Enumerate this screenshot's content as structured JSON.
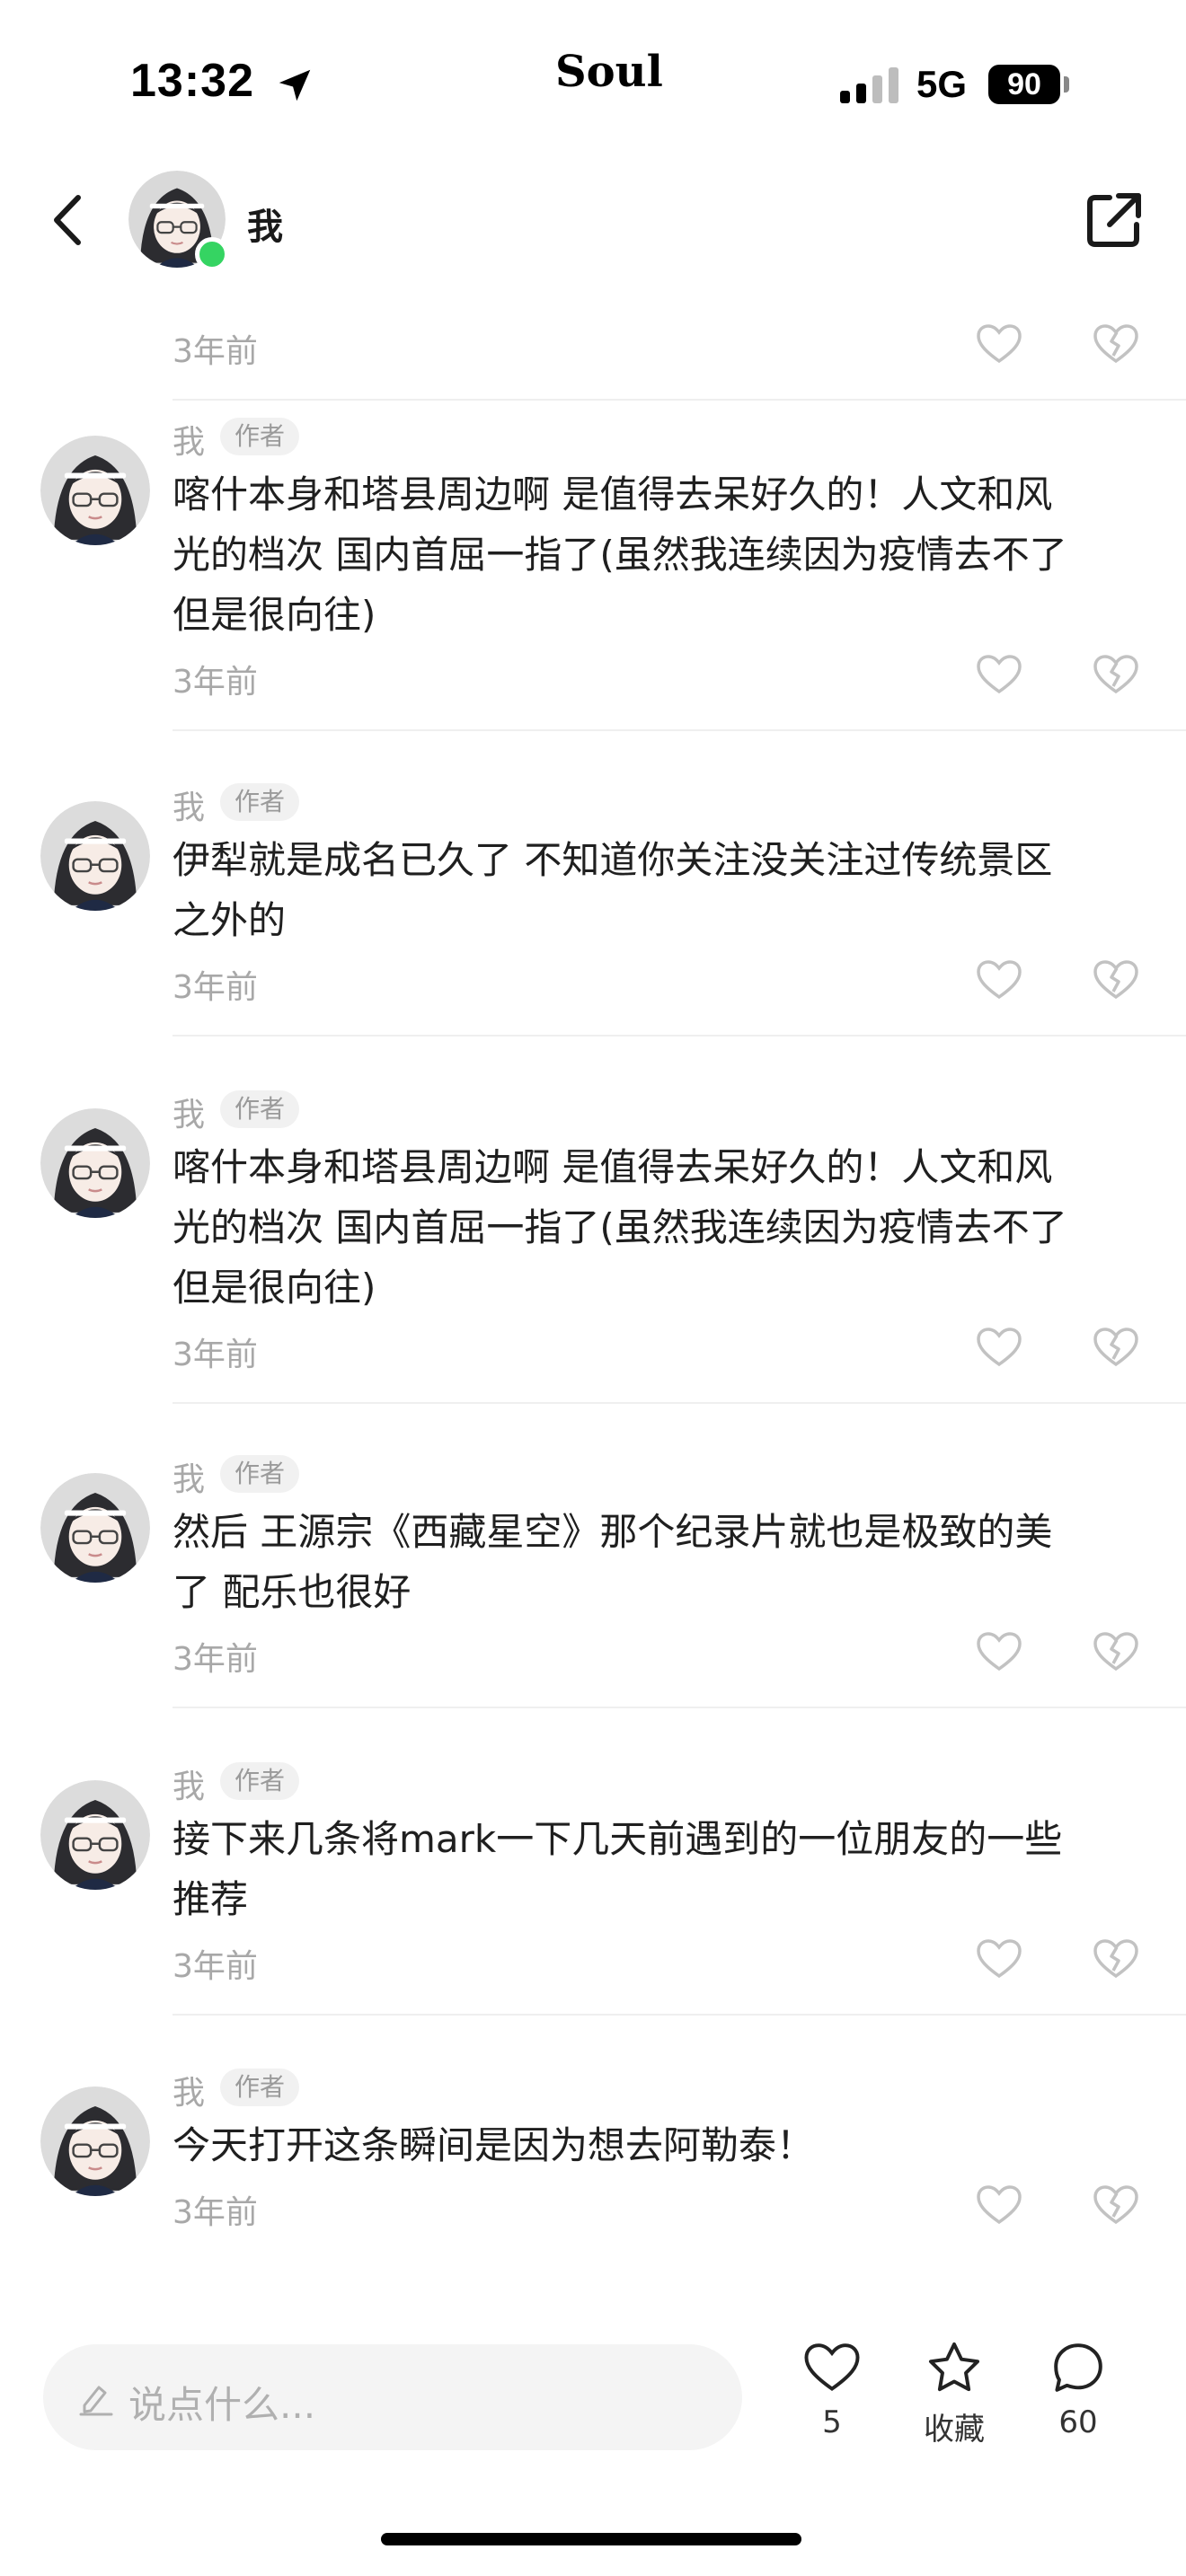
{
  "status_bar": {
    "time": "13:32",
    "carrier_logo": "Soul",
    "network": "5G",
    "battery": "90"
  },
  "header": {
    "name": "我",
    "icons": [
      "back-icon",
      "avatar",
      "share-icon"
    ]
  },
  "partial_top_comment": {
    "time": "3年前"
  },
  "comments": [
    {
      "author": "我",
      "badge": "作者",
      "text": "喀什本身和塔县周边啊 是值得去呆好久的！人文和风\n光的档次 国内首屈一指了(虽然我连续因为疫情去不了\n但是很向往)",
      "time": "3年前"
    },
    {
      "author": "我",
      "badge": "作者",
      "text": "伊犁就是成名已久了 不知道你关注没关注过传统景区\n之外的",
      "time": "3年前"
    },
    {
      "author": "我",
      "badge": "作者",
      "text": "喀什本身和塔县周边啊 是值得去呆好久的！人文和风\n光的档次 国内首屈一指了(虽然我连续因为疫情去不了\n但是很向往)",
      "time": "3年前"
    },
    {
      "author": "我",
      "badge": "作者",
      "text": "然后 王源宗《西藏星空》那个纪录片就也是极致的美\n了 配乐也很好",
      "time": "3年前"
    },
    {
      "author": "我",
      "badge": "作者",
      "text": "接下来几条将mark一下几天前遇到的一位朋友的一些\n推荐",
      "time": "3年前"
    },
    {
      "author": "我",
      "badge": "作者",
      "text": "今天打开这条瞬间是因为想去阿勒泰！",
      "time": "3年前"
    }
  ],
  "bottom_bar": {
    "input_placeholder": "说点什么...",
    "like_count": "5",
    "favorite_label": "收藏",
    "comment_count": "60"
  }
}
